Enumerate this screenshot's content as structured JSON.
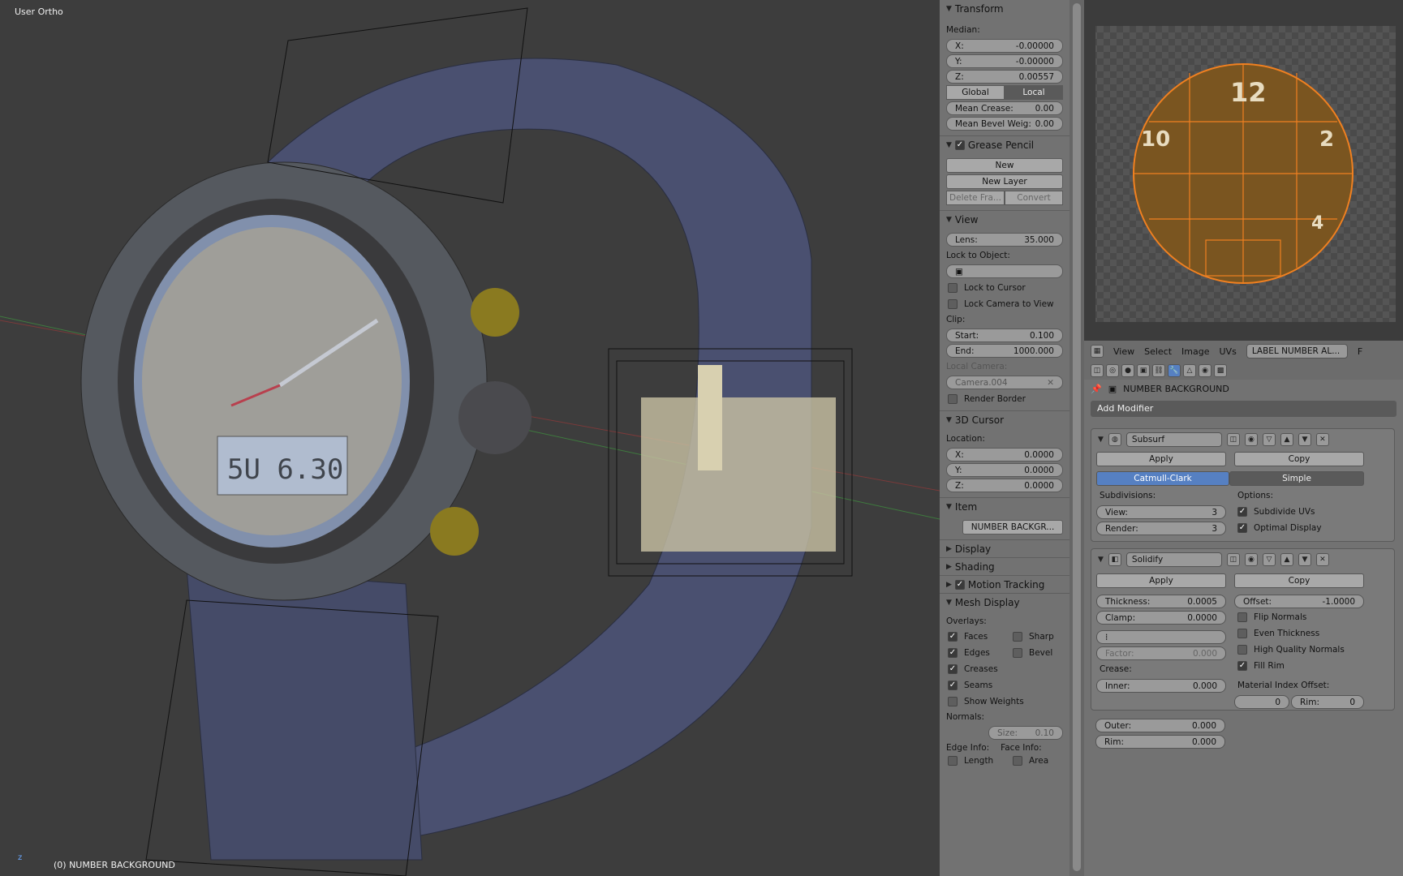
{
  "viewport": {
    "title": "User Ortho",
    "status": "(0) NUMBER BACKGROUND"
  },
  "npanel": {
    "transform": {
      "header": "Transform",
      "median_label": "Median:",
      "x_label": "X:",
      "x": "-0.00000",
      "y_label": "Y:",
      "y": "-0.00000",
      "z_label": "Z:",
      "z": "0.00557",
      "global": "Global",
      "local": "Local",
      "crease_label": "Mean Crease:",
      "crease": "0.00",
      "bevel_label": "Mean Bevel Weig:",
      "bevel": "0.00"
    },
    "grease": {
      "header": "Grease Pencil",
      "new": "New",
      "new_layer": "New Layer",
      "delete_frame": "Delete Fra...",
      "convert": "Convert"
    },
    "view": {
      "header": "View",
      "lens_label": "Lens:",
      "lens": "35.000",
      "lock_object": "Lock to Object:",
      "lock_cursor": "Lock to Cursor",
      "lock_camera": "Lock Camera to View",
      "clip": "Clip:",
      "start_label": "Start:",
      "start": "0.100",
      "end_label": "End:",
      "end": "1000.000",
      "local_camera": "Local Camera:",
      "camera": "Camera.004",
      "render_border": "Render Border"
    },
    "cursor": {
      "header": "3D Cursor",
      "location": "Location:",
      "x_label": "X:",
      "x": "0.0000",
      "y_label": "Y:",
      "y": "0.0000",
      "z_label": "Z:",
      "z": "0.0000"
    },
    "item": {
      "header": "Item",
      "name": "NUMBER BACKGR..."
    },
    "display": "Display",
    "shading": "Shading",
    "motion": "Motion Tracking",
    "mesh": {
      "header": "Mesh Display",
      "overlays": "Overlays:",
      "faces": "Faces",
      "sharp": "Sharp",
      "edges": "Edges",
      "bevel": "Bevel",
      "creases": "Creases",
      "seams": "Seams",
      "show_weights": "Show Weights",
      "normals": "Normals:",
      "size_label": "Size:",
      "size": "0.10",
      "edge_info": "Edge Info:",
      "face_info": "Face Info:",
      "length": "Length",
      "area": "Area"
    }
  },
  "uvbar": {
    "view": "View",
    "select": "Select",
    "image": "Image",
    "uvs": "UVs",
    "image_name": "LABEL NUMBER AL...",
    "f": "F"
  },
  "props": {
    "object": "NUMBER BACKGROUND",
    "add_modifier": "Add Modifier",
    "subsurf": {
      "name": "Subsurf",
      "apply": "Apply",
      "copy": "Copy",
      "catmull": "Catmull-Clark",
      "simple": "Simple",
      "subdivisions": "Subdivisions:",
      "options": "Options:",
      "view_label": "View:",
      "view": "3",
      "render_label": "Render:",
      "render": "3",
      "subdivide_uvs": "Subdivide UVs",
      "optimal": "Optimal Display"
    },
    "solidify": {
      "name": "Solidify",
      "apply": "Apply",
      "copy": "Copy",
      "thickness_label": "Thickness:",
      "thickness": "0.0005",
      "offset_label": "Offset:",
      "offset": "-1.0000",
      "clamp_label": "Clamp:",
      "clamp": "0.0000",
      "flip": "Flip Normals",
      "even": "Even Thickness",
      "hq": "High Quality Normals",
      "fill_rim": "Fill Rim",
      "factor_label": "Factor:",
      "factor": "0.000",
      "crease": "Crease:",
      "mat_offset": "Material Index Offset:",
      "inner_label": "Inner:",
      "inner": "0.000",
      "outer_label": "Outer:",
      "outer": "0.000",
      "rim_label": "Rim:",
      "rim": "0.000",
      "mio": "0",
      "mio_rim_label": "Rim:",
      "mio_rim": "0"
    }
  },
  "colors": {
    "accent": "#5680c2",
    "strap": "#4a5070",
    "uv_orange": "#f08020"
  }
}
